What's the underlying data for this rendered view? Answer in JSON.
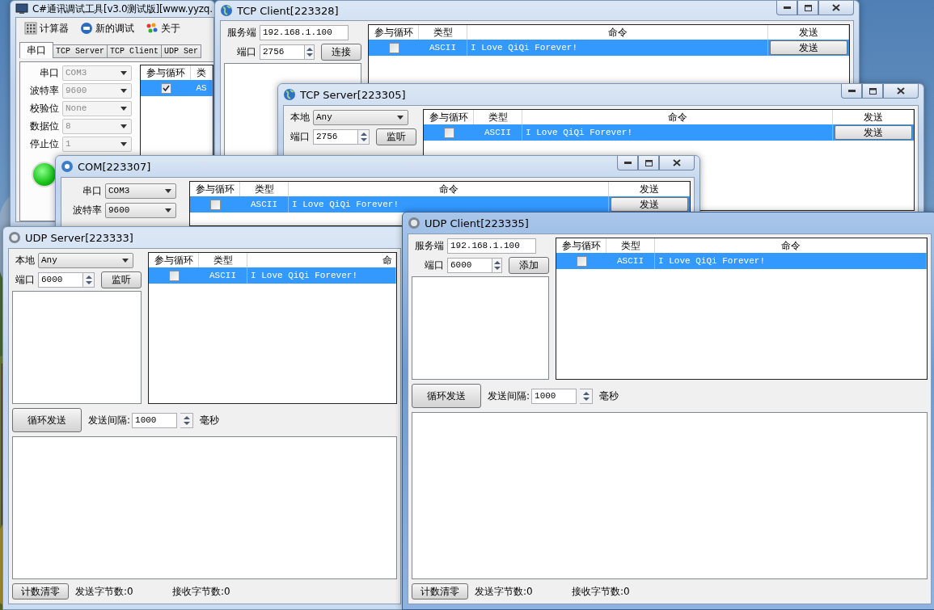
{
  "windows": [
    {
      "kind": "main",
      "title": "C#通讯调试工具[v3.0测试版][www.yyzq.",
      "active": false,
      "toolbar": [
        {
          "kind": "calculator",
          "label": "计算器"
        },
        {
          "kind": "new",
          "label": "新的调试"
        },
        {
          "kind": "about",
          "label": "关于"
        }
      ],
      "tabs": [
        {
          "label": "串口",
          "selected": true
        },
        {
          "label": "TCP Server",
          "selected": false
        },
        {
          "label": "TCP Client",
          "selected": false
        },
        {
          "label": "UDP Ser",
          "selected": false
        }
      ],
      "fields": [
        {
          "label": "串口",
          "value": "COM3",
          "disabled": true
        },
        {
          "label": "波特率",
          "value": "9600",
          "disabled": true
        },
        {
          "label": "校验位",
          "value": "None",
          "disabled": true
        },
        {
          "label": "数据位",
          "value": "8",
          "disabled": true
        },
        {
          "label": "停止位",
          "value": "1",
          "disabled": true
        }
      ],
      "status_light": {
        "on": true
      },
      "grid": {
        "columns": [
          "参与循环",
          "类"
        ],
        "rows": [
          {
            "loop": true,
            "type": "AS",
            "selected": true
          }
        ]
      }
    },
    {
      "kind": "tcp_client",
      "title": "TCP Client[223328]",
      "active": false,
      "server": {
        "label": "服务端",
        "value": "192.168.1.100"
      },
      "port": {
        "label": "端口",
        "value": "2756"
      },
      "button": "连接",
      "grid": {
        "columns": [
          "参与循环",
          "类型",
          "命令",
          "发送"
        ],
        "rows": [
          {
            "loop": false,
            "type": "ASCII",
            "command": "I Love QiQi Forever!",
            "send": "发送",
            "selected": true
          }
        ]
      }
    },
    {
      "kind": "tcp_server",
      "title": "TCP Server[223305]",
      "active": false,
      "local": {
        "label": "本地",
        "value": "Any"
      },
      "port": {
        "label": "端口",
        "value": "2756"
      },
      "button": "监听",
      "grid": {
        "columns": [
          "参与循环",
          "类型",
          "命令",
          "发送"
        ],
        "rows": [
          {
            "loop": false,
            "type": "ASCII",
            "command": "I Love QiQi Forever!",
            "send": "发送",
            "selected": true
          }
        ]
      }
    },
    {
      "kind": "com",
      "title": "COM[223307]",
      "active": false,
      "fields": [
        {
          "label": "串口",
          "value": "COM3",
          "disabled": false
        },
        {
          "label": "波特率",
          "value": "9600",
          "disabled": false
        }
      ],
      "grid": {
        "columns": [
          "参与循环",
          "类型",
          "命令",
          "发送"
        ],
        "rows": [
          {
            "loop": false,
            "type": "ASCII",
            "command": "I Love QiQi Forever!",
            "send": "发送",
            "selected": true
          }
        ]
      }
    },
    {
      "kind": "udp_server",
      "title": "UDP Server[223333]",
      "active": false,
      "local": {
        "label": "本地",
        "value": "Any"
      },
      "port": {
        "label": "端口",
        "value": "6000"
      },
      "button": "监听",
      "grid": {
        "columns": [
          "参与循环",
          "类型",
          "命"
        ],
        "rows": [
          {
            "loop": false,
            "type": "ASCII",
            "command": "I Love QiQi Forever!",
            "selected": true
          }
        ]
      },
      "loop_button": "循环发送",
      "interval": {
        "label": "发送间隔:",
        "value": "1000",
        "unit": "毫秒"
      },
      "status": {
        "button": "计数清零",
        "sent": "发送字节数:0",
        "received": "接收字节数:0"
      }
    },
    {
      "kind": "udp_client",
      "title": "UDP Client[223335]",
      "active": true,
      "server": {
        "label": "服务端",
        "value": "192.168.1.100"
      },
      "port": {
        "label": "端口",
        "value": "6000"
      },
      "button": "添加",
      "grid": {
        "columns": [
          "参与循环",
          "类型",
          "命令"
        ],
        "rows": [
          {
            "loop": false,
            "type": "ASCII",
            "command": "I Love QiQi Forever!",
            "selected": true
          }
        ]
      },
      "loop_button": "循环发送",
      "interval": {
        "label": "发送间隔:",
        "value": "1000",
        "unit": "毫秒"
      },
      "status": {
        "button": "计数清零",
        "sent": "发送字节数:0",
        "received": "接收字节数:0"
      }
    }
  ]
}
